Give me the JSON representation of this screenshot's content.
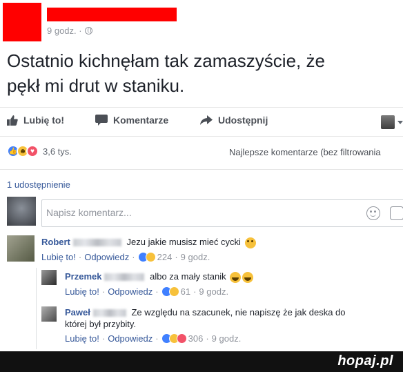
{
  "post": {
    "meta_time": "9 godz. ·",
    "text_line1": "Ostatnio kichnęłam tak zamaszyście, że",
    "text_line2": "pękł mi drut w staniku."
  },
  "actions": {
    "like": "Lubię to!",
    "comment": "Komentarze",
    "share": "Udostępnij"
  },
  "reactions": {
    "count": "3,6 tys.",
    "filter_label": "Najlepsze komentarze (bez filtrowania"
  },
  "shares": "1 udostępnienie",
  "comment_box": {
    "placeholder": "Napisz komentarz..."
  },
  "comments": [
    {
      "name": "Robert",
      "text": "Jezu jakie musisz mieć cycki",
      "like": "Lubię to!",
      "reply": "Odpowiedz",
      "reactions": "224",
      "time": "9 godz."
    },
    {
      "name": "Przemek",
      "text": "albo za mały stanik",
      "like": "Lubię to!",
      "reply": "Odpowiedz",
      "reactions": "61",
      "time": "9 godz."
    },
    {
      "name": "Paweł",
      "text_line1": "Ze względu na szacunek, nie napiszę że jak deska do",
      "text_line2": "której był przybity.",
      "like": "Lubię to!",
      "reply": "Odpowiedz",
      "reactions": "306",
      "time": "9 godz."
    }
  ],
  "brand": "hopaj.pl",
  "colors": {
    "link_blue": "#365899",
    "redaction_red": "#ff0000",
    "like_blue": "#4080ff",
    "love_red": "#f25268",
    "emoji_yellow": "#f7c13b"
  }
}
